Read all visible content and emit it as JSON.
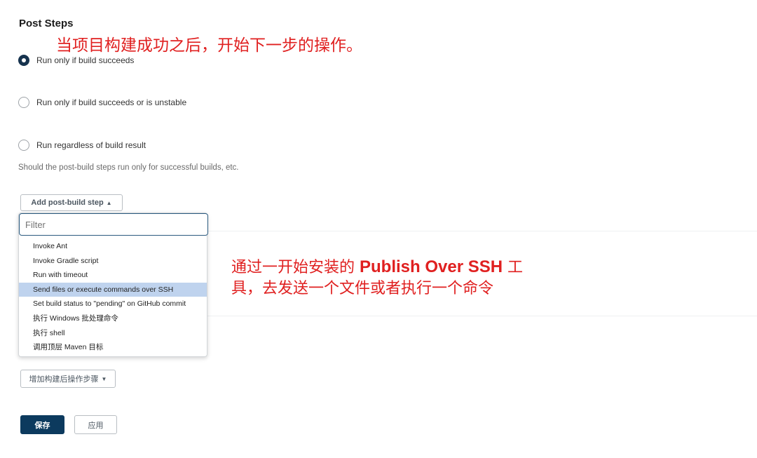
{
  "section": {
    "title": "Post Steps"
  },
  "annotations": {
    "top": "当项目构建成功之后，开始下一步的操作。",
    "middle": {
      "line1_prefix": "通过一开始安装的 ",
      "line1_emphasis": "Publish Over SSH",
      "line1_suffix": " 工",
      "line2": "具，去发送一个文件或者执行一个命令"
    }
  },
  "radios": [
    {
      "label": "Run only if build succeeds",
      "checked": true
    },
    {
      "label": "Run only if build succeeds or is unstable",
      "checked": false
    },
    {
      "label": "Run regardless of build result",
      "checked": false
    }
  ],
  "help_text": "Should the post-build steps run only for successful builds, etc.",
  "add_step_button": {
    "label": "Add post-build step",
    "caret": "▲"
  },
  "filter": {
    "placeholder": "Filter",
    "value": ""
  },
  "menu_items": [
    "Invoke Ant",
    "Invoke Gradle script",
    "Run with timeout",
    "Send files or execute commands over SSH",
    "Set build status to \"pending\" on GitHub commit",
    "执行 Windows 批处理命令",
    "执行 shell",
    "调用顶层 Maven 目标"
  ],
  "highlighted_item": "Send files or execute commands over SSH",
  "add_post_build_action_button": {
    "label": "增加构建后操作步骤",
    "caret": "▼"
  },
  "actions": {
    "save_label": "保存",
    "apply_label": "应用"
  },
  "colors": {
    "accent": "#0c3a5e",
    "annotation": "#e02020",
    "highlight": "#bfd3ee"
  }
}
